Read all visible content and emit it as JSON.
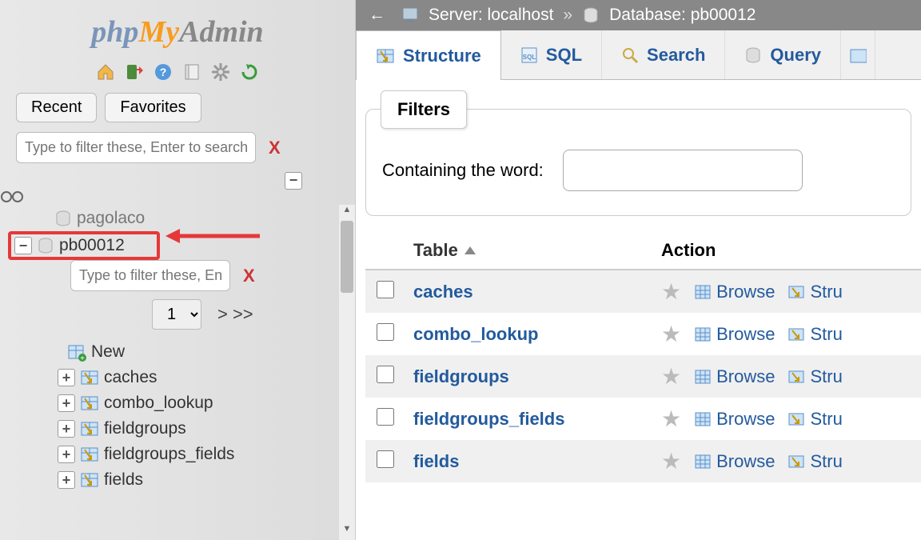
{
  "logo": {
    "php": "php",
    "my": "My",
    "admin": "Admin"
  },
  "sidebar": {
    "recent": "Recent",
    "favorites": "Favorites",
    "filter_placeholder": "Type to filter these, Enter to search al",
    "sub_filter_placeholder": "Type to filter these, Enter t",
    "cut_item": "pagolaco",
    "db_name": "pb00012",
    "page_selected": "1",
    "page_more": "> >>",
    "new_label": "New",
    "tables": [
      "caches",
      "combo_lookup",
      "fieldgroups",
      "fieldgroups_fields",
      "fields"
    ]
  },
  "breadcrumb": {
    "server_label": "Server:",
    "server_value": "localhost",
    "db_label": "Database:",
    "db_value": "pb00012"
  },
  "tabs": {
    "structure": "Structure",
    "sql": "SQL",
    "search": "Search",
    "query": "Query"
  },
  "filters": {
    "legend": "Filters",
    "containing": "Containing the word:"
  },
  "table": {
    "header_table": "Table",
    "header_action": "Action",
    "browse": "Browse",
    "structure": "Stru",
    "rows": [
      "caches",
      "combo_lookup",
      "fieldgroups",
      "fieldgroups_fields",
      "fields"
    ]
  }
}
